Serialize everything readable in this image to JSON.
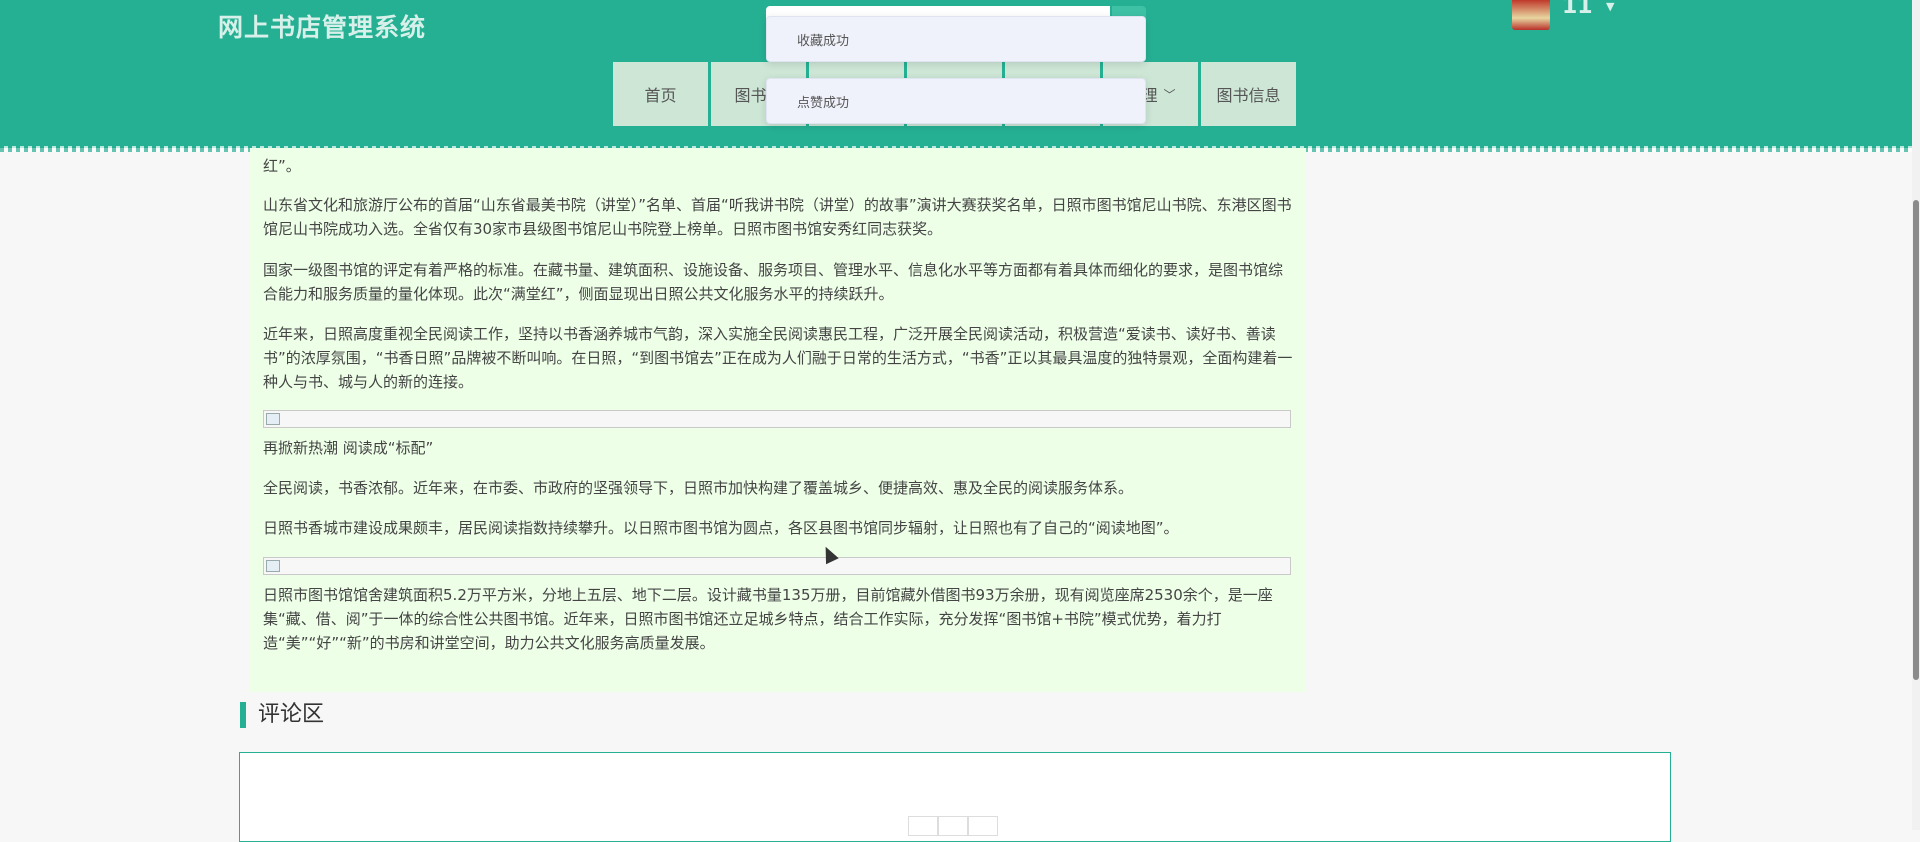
{
  "header": {
    "site_title": "网上书店管理系统",
    "username": "11",
    "nav": [
      {
        "label": "首页"
      },
      {
        "label": "图书讯"
      },
      {
        "label": ""
      },
      {
        "label": ""
      },
      {
        "label": ""
      },
      {
        "label": "管理"
      },
      {
        "label": "图书信息"
      }
    ]
  },
  "toasts": {
    "favorite": "收藏成功",
    "like": "点赞成功"
  },
  "article": {
    "paragraphs": [
      "红”。",
      "山东省文化和旅游厅公布的首届“山东省最美书院（讲堂）”名单、首届“听我讲书院（讲堂）的故事”演讲大赛获奖名单，日照市图书馆尼山书院、东港区图书馆尼山书院成功入选。全省仅有30家市县级图书馆尼山书院登上榜单。日照市图书馆安秀红同志获奖。",
      "国家一级图书馆的评定有着严格的标准。在藏书量、建筑面积、设施设备、服务项目、管理水平、信息化水平等方面都有着具体而细化的要求，是图书馆综合能力和服务质量的量化体现。此次“满堂红”，侧面显现出日照公共文化服务水平的持续跃升。",
      "近年来，日照高度重视全民阅读工作，坚持以书香涵养城市气韵，深入实施全民阅读惠民工程，广泛开展全民阅读活动，积极营造“爱读书、读好书、善读书”的浓厚氛围，“书香日照”品牌被不断叫响。在日照，“到图书馆去”正在成为人们融于日常的生活方式，“书香”正以其最具温度的独特景观，全面构建着一种人与书、城与人的新的连接。",
      "再掀新热潮 阅读成“标配”",
      "全民阅读，书香浓郁。近年来，在市委、市政府的坚强领导下，日照市加快构建了覆盖城乡、便捷高效、惠及全民的阅读服务体系。",
      "日照书香城市建设成果颇丰，居民阅读指数持续攀升。以日照市图书馆为圆点，各区县图书馆同步辐射，让日照也有了自己的“阅读地图”。",
      "日照市图书馆馆舍建筑面积5.2万平方米，分地上五层、地下二层。设计藏书量135万册，目前馆藏外借图书93万余册，现有阅览座席2530余个，是一座集“藏、借、阅”于一体的综合性公共图书馆。近年来，日照市图书馆还立足城乡特点，结合工作实际，充分发挥“图书馆+书院”模式优势，着力打造“美”“好”“新”的书房和讲堂空间，助力公共文化服务高质量发展。"
    ]
  },
  "comments": {
    "title": "评论区"
  },
  "colors": {
    "header": "#26b093",
    "nav_item": "#cde6d6",
    "article_bg": "#eeffe8",
    "accent": "#26b093"
  }
}
